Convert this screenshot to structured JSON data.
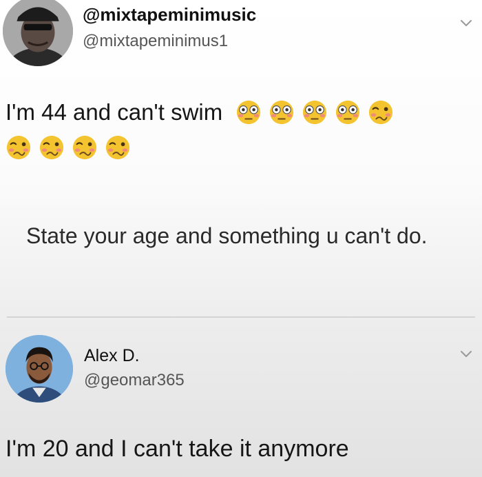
{
  "tweets": [
    {
      "display_name": "@mixtapeminimusic",
      "handle": "@mixtapeminimus1",
      "text": "I'm 44 and can't swim",
      "emojis": [
        "flushed-face",
        "flushed-face",
        "flushed-face",
        "flushed-face",
        "woozy-face",
        "woozy-face",
        "woozy-face",
        "woozy-face",
        "woozy-face"
      ],
      "avatar": "man-in-cap-avatar"
    },
    {
      "display_name": "Alex D.",
      "handle": "@geomar365",
      "text": "I'm 20 and I can't take it anymore",
      "avatar": "man-with-glasses-avatar"
    }
  ],
  "quoted_text": "State your age and something u can't do.",
  "icons": {
    "menu": "chevron-down-icon"
  },
  "colors": {
    "text": "#161616",
    "handle": "#555555",
    "divider": "#d4d4d4",
    "emoji_face": "#f4c430"
  }
}
